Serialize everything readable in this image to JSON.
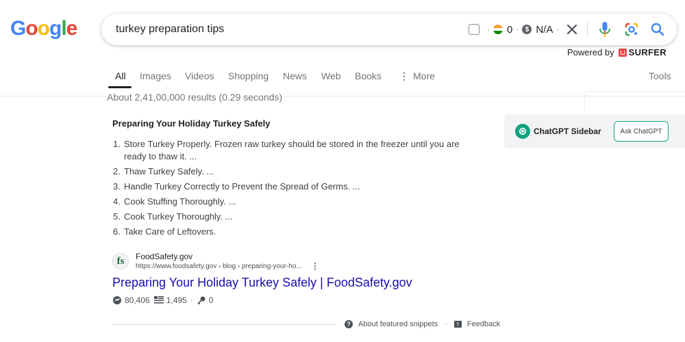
{
  "logo": {
    "letters": [
      "G",
      "o",
      "o",
      "g",
      "l",
      "e"
    ],
    "colors": [
      "#4285F4",
      "#EA4335",
      "#FBBC05",
      "#4285F4",
      "#34A853",
      "#EA4335"
    ]
  },
  "search": {
    "query": "turkey preparation tips"
  },
  "extension": {
    "rank_value": "0",
    "cost_value": "N/A",
    "coin_symbol": "$",
    "separator": "·"
  },
  "powered": {
    "label": "Powered by",
    "brand": "SURFER"
  },
  "tabs": [
    {
      "label": "All",
      "active": true
    },
    {
      "label": "Images"
    },
    {
      "label": "Videos"
    },
    {
      "label": "Shopping"
    },
    {
      "label": "News"
    },
    {
      "label": "Web"
    },
    {
      "label": "Books"
    },
    {
      "label": "More"
    }
  ],
  "tools_label": "Tools",
  "result_stats": "About 2,41,00,000 results (0.29 seconds)",
  "snippet": {
    "title": "Preparing Your Holiday Turkey Safely",
    "steps": [
      {
        "num": "1.",
        "text": "Store Turkey Properly. Frozen raw turkey should be stored in the freezer until you are ready to thaw it. ..."
      },
      {
        "num": "2.",
        "text": "Thaw Turkey Safely. ..."
      },
      {
        "num": "3.",
        "text": "Handle Turkey Correctly to Prevent the Spread of Germs. ..."
      },
      {
        "num": "4.",
        "text": "Cook Stuffing Thoroughly. ..."
      },
      {
        "num": "5.",
        "text": "Cook Turkey Thoroughly. ..."
      },
      {
        "num": "6.",
        "text": "Take Care of Leftovers."
      }
    ]
  },
  "source": {
    "logo_text": "fs",
    "name": "FoodSafety.gov",
    "url": "https://www.foodsafety.gov › blog › preparing-your-ho...",
    "link_title": "Preparing Your Holiday Turkey Safely | FoodSafety.gov",
    "metrics": {
      "traffic": "80,406",
      "words": "1,495",
      "keywords": "0",
      "separator": "·"
    }
  },
  "footer": {
    "about": "About featured snippets",
    "feedback": "Feedback",
    "separator": "·"
  },
  "gpt": {
    "title": "ChatGPT Sidebar",
    "button": "Ask ChatGPT",
    "accent": "#10a37f"
  },
  "colors": {
    "link": "#1a0dab",
    "muted": "#70757a",
    "surfer_red": "#ef4444"
  }
}
